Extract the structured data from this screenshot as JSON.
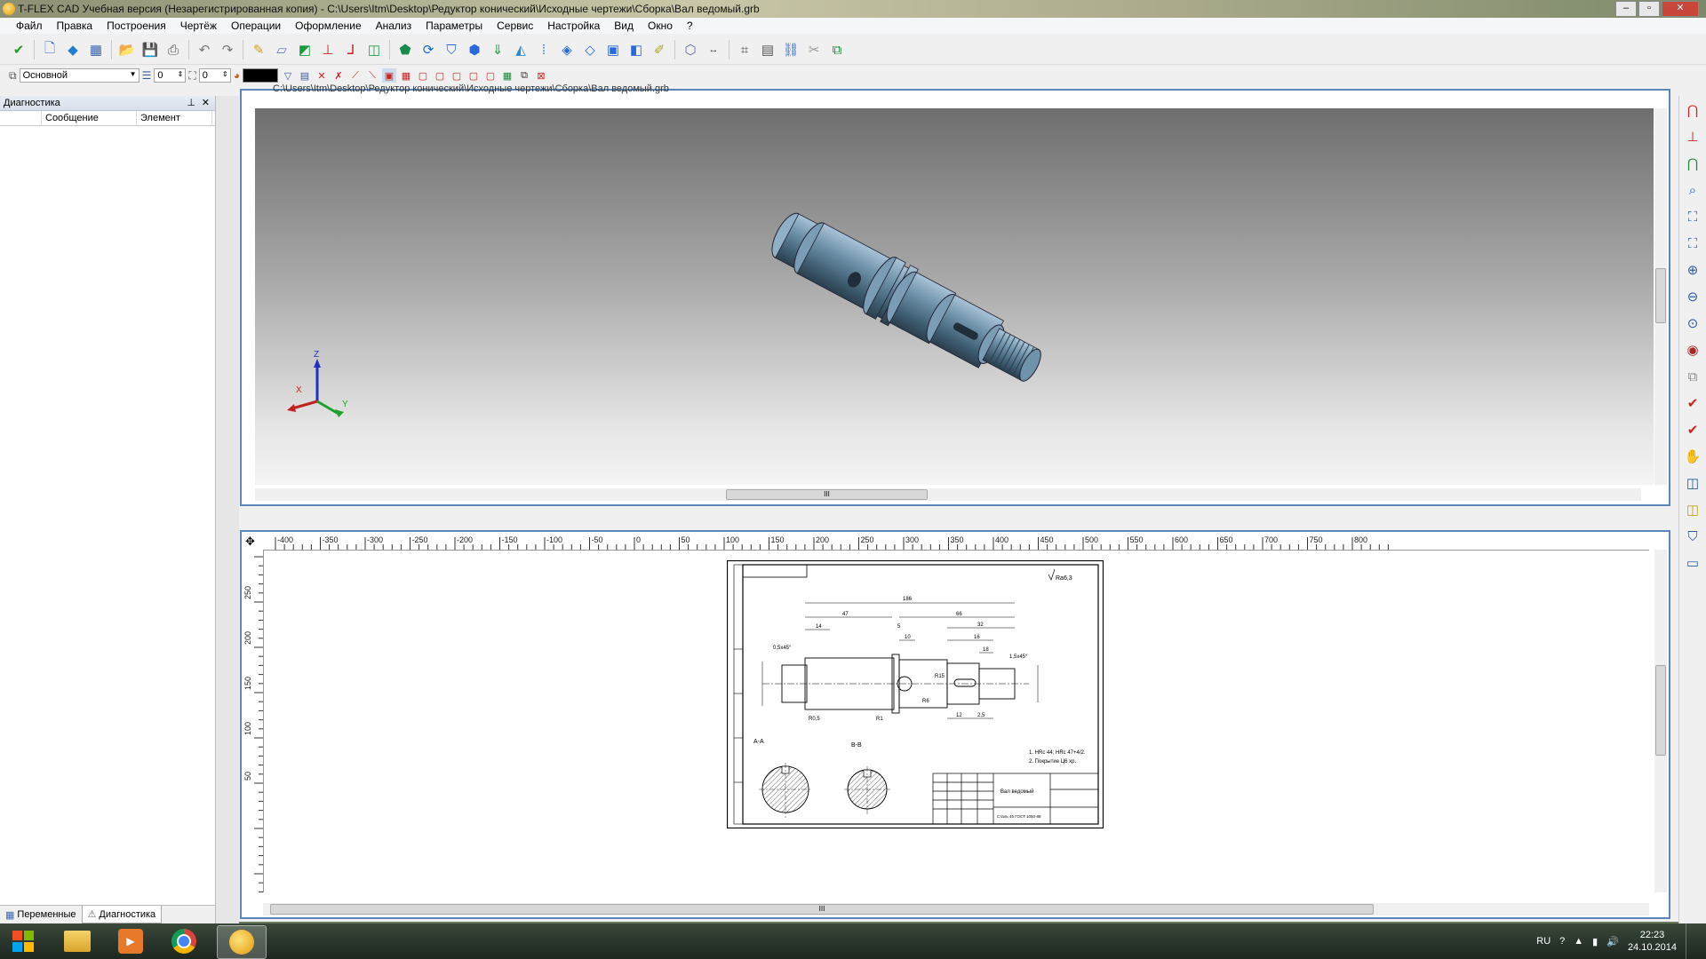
{
  "window": {
    "title": "T-FLEX CAD Учебная версия (Незарегистрированная копия) - C:\\Users\\Itm\\Desktop\\Редуктор конический\\Исходные чертежи\\Сборка\\Вал ведомый.grb"
  },
  "menu": [
    "Файл",
    "Правка",
    "Построения",
    "Чертёж",
    "Операции",
    "Оформление",
    "Анализ",
    "Параметры",
    "Сервис",
    "Настройка",
    "Вид",
    "Окно",
    "?"
  ],
  "toolbar2": {
    "layer": "Основной",
    "level_value": "0",
    "priority_value": "0",
    "color": "#000000"
  },
  "left_panel": {
    "title": "Диагностика",
    "columns": [
      "Сообщение",
      "Элемент"
    ],
    "tabs": [
      "Переменные",
      "Диагностика"
    ]
  },
  "doc3d": {
    "path": "C:\\Users\\Itm\\Desktop\\Редуктор конический\\Исходные чертежи\\Сборка\\Вал ведомый.grb",
    "axes": [
      "X",
      "Y",
      "Z"
    ],
    "scroll_grip": "III"
  },
  "doc2d": {
    "ruler_h": [
      "-400",
      "-350",
      "-300",
      "-250",
      "-200",
      "-150",
      "-100",
      "-50",
      "0",
      "50",
      "100",
      "150",
      "200",
      "250",
      "300",
      "350",
      "400",
      "450",
      "500",
      "550",
      "600",
      "650",
      "700",
      "750",
      "800"
    ],
    "ruler_v": [
      "250",
      "200",
      "150",
      "100",
      "50"
    ],
    "scroll_grip": "III",
    "drawing": {
      "roughness": "Ra6,3",
      "notes": [
        "1. HRc 44; HRc 47+4/2.",
        "2. Покрытие Ц6 хр."
      ],
      "name": "Вал ведомый",
      "material": "Сталь 45 ГОСТ 1050-88",
      "sections": [
        "А-А",
        "В-В"
      ],
      "dims": [
        "186",
        "47",
        "66",
        "14",
        "32",
        "10",
        "16",
        "18",
        "5",
        "12",
        "2,5",
        "1,5x45°",
        "0,5x45°",
        "R0,5",
        "R1",
        "R15",
        "R6"
      ]
    }
  },
  "statusline": ">",
  "taskbar": {
    "lang": "RU",
    "time": "22:23",
    "date": "24.10.2014"
  }
}
